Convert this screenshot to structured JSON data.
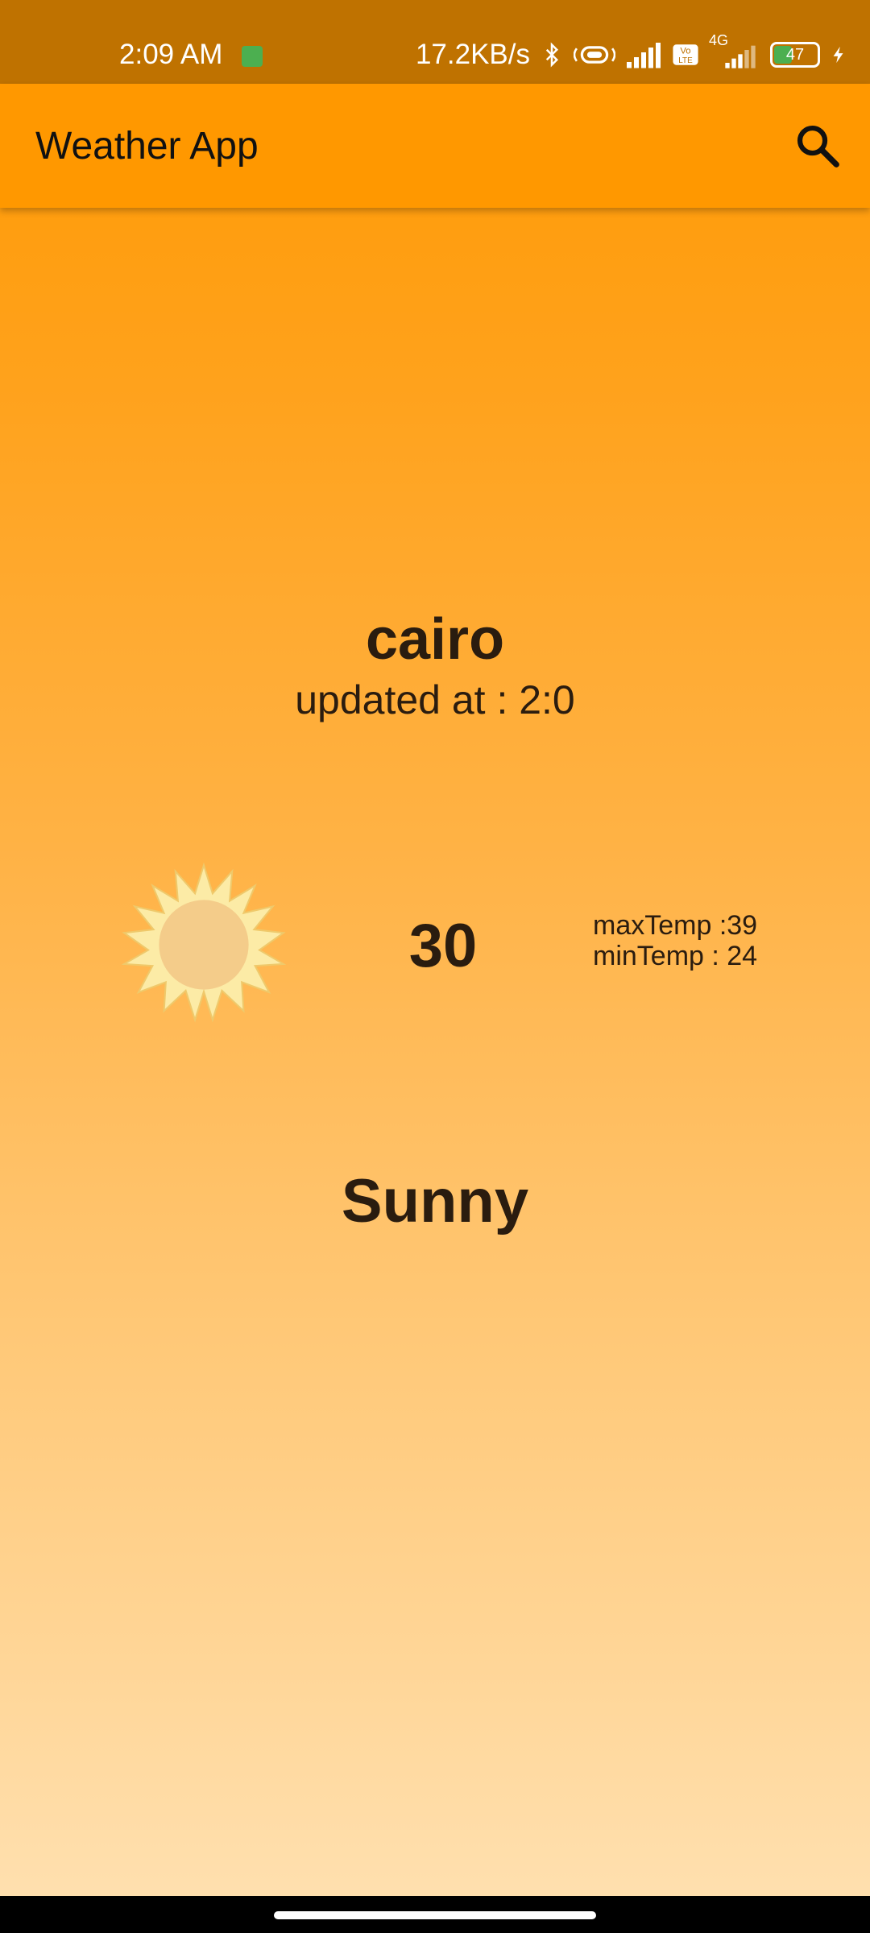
{
  "status_bar": {
    "time": "2:09 AM",
    "speed": "17.2KB/s",
    "network": "4G",
    "battery": "47",
    "battery_level": 0.47,
    "icons": [
      "notification-app-icon",
      "bluetooth-icon",
      "vibrate-icon",
      "signal-icon",
      "volte-icon",
      "signal-4g-icon",
      "battery-icon",
      "charging-icon"
    ]
  },
  "app_bar": {
    "title": "Weather App",
    "search_icon": "search-icon"
  },
  "weather": {
    "city": "cairo",
    "updated": "updated at : 2:0",
    "icon": "sun-icon",
    "temp": "30",
    "max_temp": "maxTemp :39",
    "min_temp": "minTemp : 24",
    "condition": "Sunny"
  },
  "colors": {
    "status_bar": "#BF7200",
    "app_bar": "#FF9800",
    "gradient_top": "#FF9800",
    "gradient_bottom": "#FFE1B2",
    "text": "#2a1c0f"
  }
}
